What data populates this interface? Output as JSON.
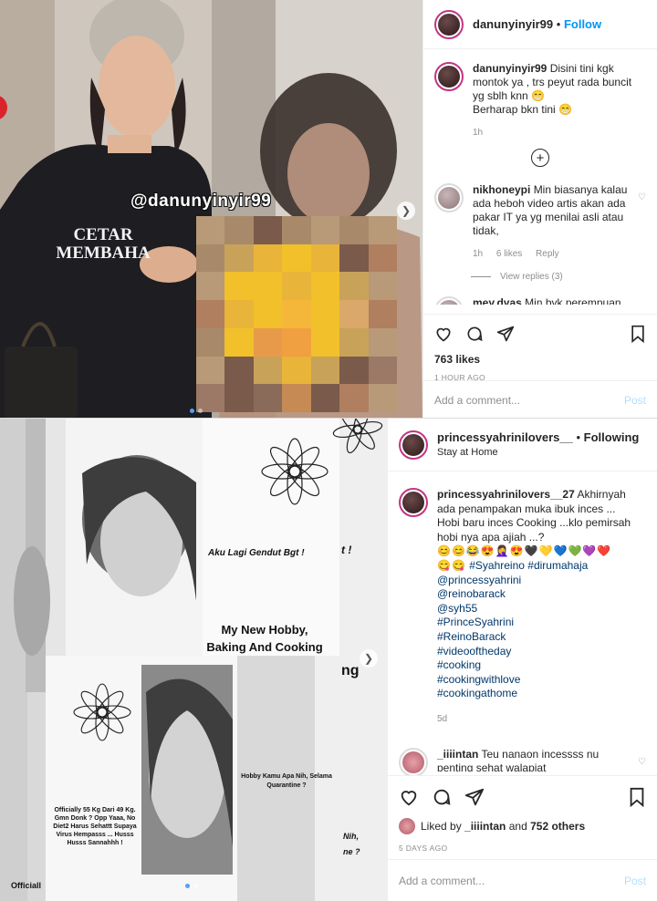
{
  "post1": {
    "username": "danunyinyir99",
    "dot": "•",
    "follow_label": "Follow",
    "watermark": "@danunyinyir99",
    "shirt_text": [
      "CETAR",
      "MEMBAHA"
    ],
    "caption": {
      "username": "danunyinyir99",
      "text": "Disini tini kgk montok ya , trs peyut rada buncit yg sblh knn 😁",
      "line2": "Berharap bkn tini 😁",
      "time": "1h"
    },
    "comment": {
      "username": "nikhoneypi",
      "text": "Min biasanya kalau ada heboh video artis akan ada pakar IT ya yg menilai asli atau tidak,",
      "time": "1h",
      "likes": "6 likes",
      "reply": "Reply",
      "view_replies": "View replies (3)"
    },
    "next_comment": {
      "username": "mey.dyas",
      "text": "Min byk perempuan"
    },
    "likes": "763 likes",
    "time_ago": "1 HOUR AGO",
    "add_comment_placeholder": "Add a comment...",
    "post_label": "Post"
  },
  "post2": {
    "username": "princessyahrinilovers__",
    "dot": "•",
    "following_label": "Following",
    "location": "Stay at Home",
    "slide_texts": {
      "gendut": "Aku Lagi Gendut Bgt !",
      "hobby": "My New Hobby, Baking And Cooking",
      "quarantine": "Hobby Kamu Apa Nih, Selama Quarantine ?",
      "officially": "Officially 55 Kg Dari 49 Kg. Gmn Donk ? Opp Yaaa, No Diet2 Harus Sehattt Supaya Virus Hempasss ... Husss Husss Sannahhh !",
      "officiall": "Officiall",
      "ng": "ng",
      "nih": "Nih,",
      "ne": "ne ?",
      "t": "t !"
    },
    "caption": {
      "username": "princessyahrinilovers__27",
      "text": "Akhirnyah ada penampakan muka ibuk inces ... Hobi baru inces Cooking ...klo pemirsah hobi nya apa ajiah ...?",
      "emojis": "😊😊😂😍🤦‍♀️😍🖤💛💙💚💜❤️",
      "emojis2": "😋😋",
      "tags": [
        "#Syahreino #dirumahaja",
        "@princessyahrini",
        "@reinobarack",
        "@syh55",
        "#PrinceSyahrini",
        "#ReinoBarack",
        "#videooftheday",
        "#cooking",
        "#cookingwithlove",
        "#cookingathome"
      ],
      "time": "5d"
    },
    "comment": {
      "username": "_iiiintan",
      "text": "Teu nanaon incessss nu penting sehat walapiat"
    },
    "liked_by_prefix": "Liked by",
    "liked_by_user": "_iiiintan",
    "liked_by_and": "and",
    "liked_by_others": "752 others",
    "time_ago": "5 DAYS AGO",
    "add_comment_placeholder": "Add a comment...",
    "post_label": "Post"
  },
  "colors": {
    "link_blue": "#0095f6",
    "hashtag": "#00376b",
    "muted": "#8e8e8e",
    "border": "#dbdbdb"
  }
}
